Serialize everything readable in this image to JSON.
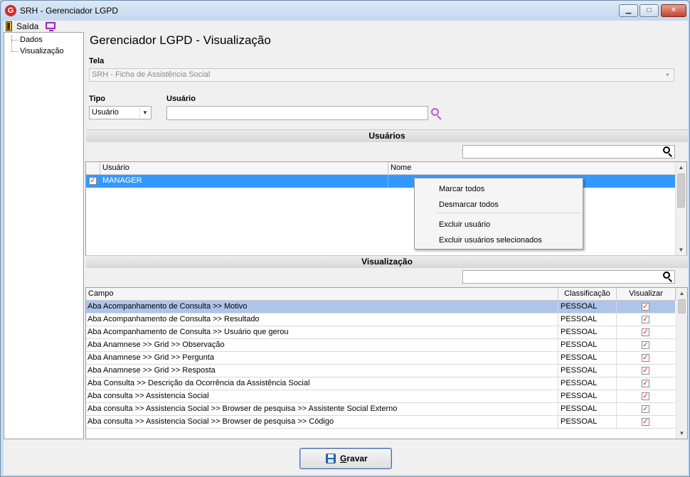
{
  "window": {
    "title": "SRH - Gerenciador LGPD",
    "app_icon_letter": "G",
    "controls": {
      "minimize": "▁",
      "maximize": "□",
      "close": "✕"
    }
  },
  "menu": {
    "saida_label": "Saída",
    "icons": [
      "door-exit-icon",
      "monitor-icon"
    ]
  },
  "tree": {
    "items": [
      {
        "label": "Dados"
      },
      {
        "label": "Visualização"
      }
    ]
  },
  "page_title": "Gerenciador LGPD - Visualização",
  "form": {
    "tela_label": "Tela",
    "tela_value": "SRH - Ficha de Assistência Social",
    "tipo_label": "Tipo",
    "tipo_value": "Usuário",
    "usuario_label": "Usuário",
    "usuario_value": ""
  },
  "usuarios_section": {
    "title": "Usuários",
    "search_value": "",
    "columns": [
      "Usuário",
      "Nome"
    ],
    "rows": [
      {
        "checked": true,
        "usuario": "MANAGER",
        "nome": ""
      }
    ]
  },
  "context_menu": {
    "items": [
      "Marcar todos",
      "Desmarcar todos",
      "Excluir usuário",
      "Excluir usuários selecionados"
    ]
  },
  "visualizacao_section": {
    "title": "Visualização",
    "search_value": "",
    "columns": [
      "Campo",
      "Classificação",
      "Visualizar"
    ],
    "rows": [
      {
        "campo": "Aba Acompanhamento de Consulta >> Motivo",
        "classificacao": "PESSOAL",
        "visualizar": true
      },
      {
        "campo": "Aba Acompanhamento de Consulta >> Resultado",
        "classificacao": "PESSOAL",
        "visualizar": true
      },
      {
        "campo": "Aba Acompanhamento de Consulta >> Usuário que gerou",
        "classificacao": "PESSOAL",
        "visualizar": true
      },
      {
        "campo": "Aba Anamnese >> Grid >> Observação",
        "classificacao": "PESSOAL",
        "visualizar": true
      },
      {
        "campo": "Aba Anamnese >> Grid >> Pergunta",
        "classificacao": "PESSOAL",
        "visualizar": true
      },
      {
        "campo": "Aba Anamnese >> Grid >> Resposta",
        "classificacao": "PESSOAL",
        "visualizar": true
      },
      {
        "campo": "Aba Consulta >>  Descrição da Ocorrência da Assistência Social",
        "classificacao": "PESSOAL",
        "visualizar": true
      },
      {
        "campo": "Aba consulta >> Assistencia Social",
        "classificacao": "PESSOAL",
        "visualizar": true
      },
      {
        "campo": "Aba consulta >> Assistencia Social >> Browser de pesquisa >> Assistente Social Externo",
        "classificacao": "PESSOAL",
        "visualizar": true
      },
      {
        "campo": "Aba consulta >> Assistencia Social >> Browser de pesquisa >> Código",
        "classificacao": "PESSOAL",
        "visualizar": true
      }
    ]
  },
  "footer": {
    "gravar_label_first": "G",
    "gravar_label_rest": "ravar"
  },
  "colors": {
    "selection": "#3399ff",
    "selected_row": "#aec4eb",
    "check": "#d81b1b",
    "search_purple": "#b55dc9"
  }
}
